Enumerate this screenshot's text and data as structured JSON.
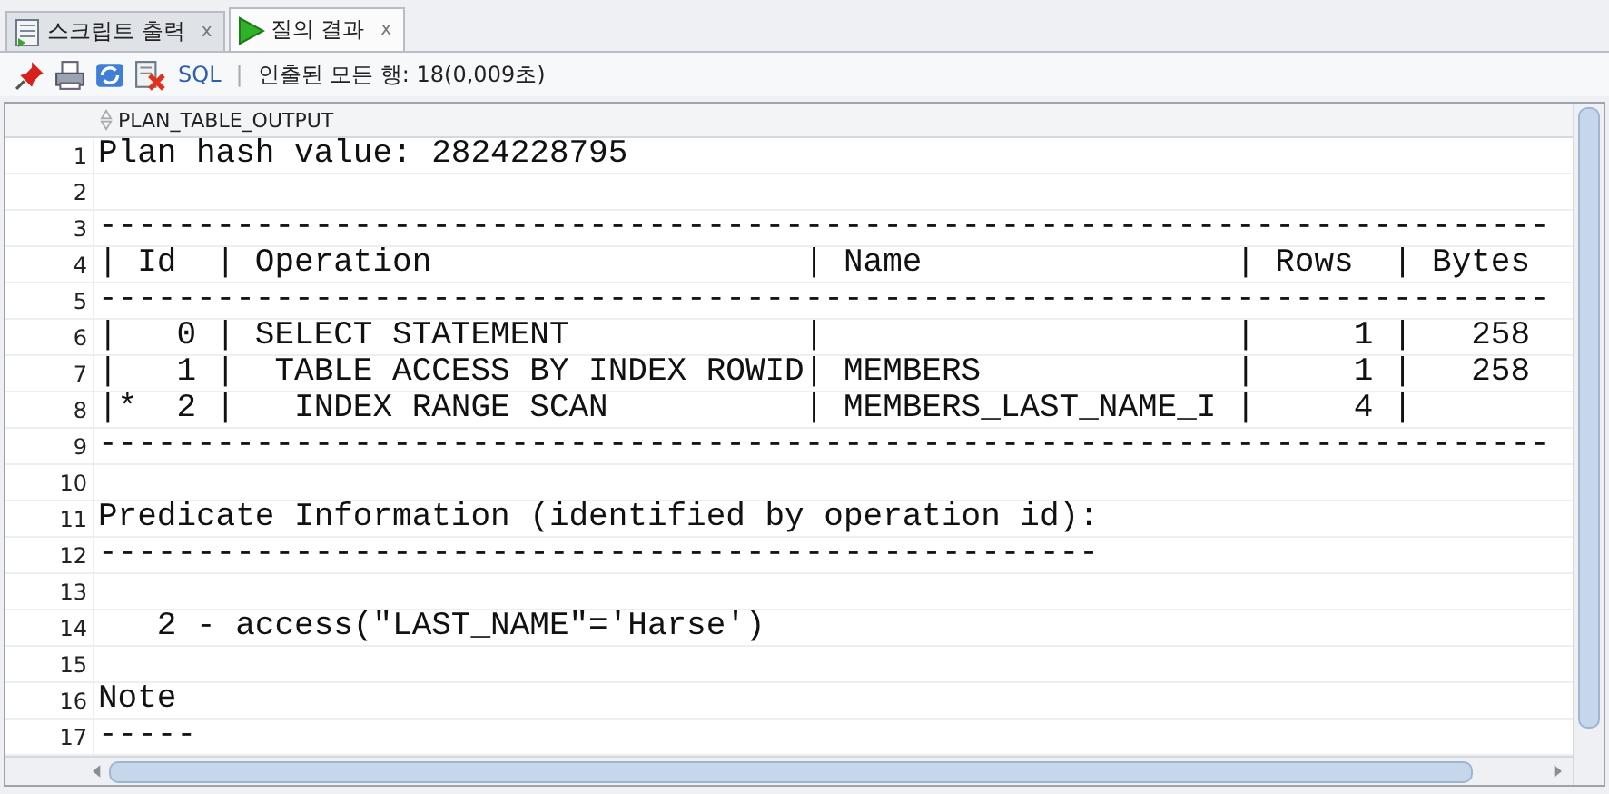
{
  "tabs": [
    {
      "label": "스크립트 출력",
      "kind": "script",
      "selected": false,
      "close": "x"
    },
    {
      "label": "질의 결과",
      "kind": "run",
      "selected": true,
      "close": "x"
    }
  ],
  "toolbar": {
    "sql_link": "SQL",
    "separator": "|",
    "status": "인출된 모든 행: 18(0,009초)"
  },
  "grid": {
    "column": "PLAN_TABLE_OUTPUT",
    "rows": [
      {
        "number": "1",
        "text": "Plan hash value: 2824228795"
      },
      {
        "number": "2"
      },
      {
        "number": "3",
        "text": "--------------------------------------------------------------------------"
      },
      {
        "number": "4",
        "text": "| Id  | Operation                   | Name                | Rows  | Bytes"
      },
      {
        "number": "5",
        "text": "--------------------------------------------------------------------------"
      },
      {
        "number": "6",
        "text": "|   0 | SELECT STATEMENT            |                     |     1 |   258"
      },
      {
        "number": "7",
        "text": "|   1 |  TABLE ACCESS BY INDEX ROWID| MEMBERS             |     1 |   258"
      },
      {
        "number": "8",
        "text": "|*  2 |   INDEX RANGE SCAN          | MEMBERS_LAST_NAME_I |     4 |"
      },
      {
        "number": "9",
        "text": "--------------------------------------------------------------------------"
      },
      {
        "number": "10"
      },
      {
        "number": "11",
        "text": "Predicate Information (identified by operation id):"
      },
      {
        "number": "12",
        "text": "---------------------------------------------------"
      },
      {
        "number": "13"
      },
      {
        "number": "14",
        "text": "   2 - access(\"LAST_NAME\"='Harse')"
      },
      {
        "number": "15"
      },
      {
        "number": "16",
        "text": "Note"
      },
      {
        "number": "17",
        "text": "-----"
      }
    ]
  }
}
